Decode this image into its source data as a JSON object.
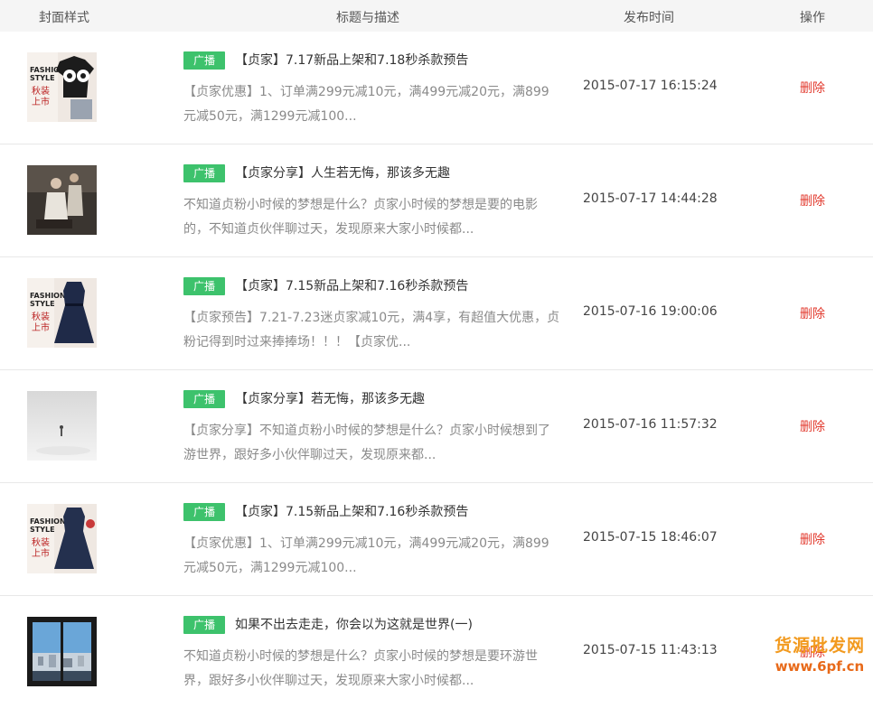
{
  "header": {
    "cover_label": "封面样式",
    "title_label": "标题与描述",
    "time_label": "发布时间",
    "action_label": "操作"
  },
  "rows": [
    {
      "badge": "广播",
      "title": "【贞家】7.17新品上架和7.18秒杀款预告",
      "desc": "【贞家优惠】1、订单满299元减10元，满499元减20元，满899元减50元，满1299元减100...",
      "time": "2015-07-17 16:15:24",
      "action": "删除",
      "cover": "fashion-panda"
    },
    {
      "badge": "广播",
      "title": "【贞家分享】人生若无悔，那该多无趣",
      "desc": "不知道贞粉小时候的梦想是什么？贞家小时候的梦想是要的电影的，不知道贞伙伴聊过天，发现原来大家小时候都...",
      "time": "2015-07-17 14:44:28",
      "action": "删除",
      "cover": "couple-photo"
    },
    {
      "badge": "广播",
      "title": "【贞家】7.15新品上架和7.16秒杀款预告",
      "desc": "【贞家预告】7.21-7.23迷贞家减10元，满4享，有超值大优惠，贞粉记得到时过来捧捧场！！！【贞家优...",
      "time": "2015-07-16 19:00:06",
      "action": "删除",
      "cover": "fashion-dress"
    },
    {
      "badge": "广播",
      "title": "【贞家分享】若无悔，那该多无趣",
      "desc": "【贞家分享】不知道贞粉小时候的梦想是什么？贞家小时候想到了游世界，跟好多小伙伴聊过天，发现原来都...",
      "time": "2015-07-16 11:57:32",
      "action": "删除",
      "cover": "misty-figure"
    },
    {
      "badge": "广播",
      "title": "【贞家】7.15新品上架和7.16秒杀款预告",
      "desc": "【贞家优惠】1、订单满299元减10元，满499元减20元，满899元减50元，满1299元减100...",
      "time": "2015-07-15 18:46:07",
      "action": "删除",
      "cover": "fashion-dress"
    },
    {
      "badge": "广播",
      "title": "如果不出去走走，你会以为这就是世界(一)",
      "desc": "不知道贞粉小时候的梦想是什么？贞家小时候的梦想是要环游世界，跟好多小伙伴聊过天，发现原来大家小时候都...",
      "time": "2015-07-15 11:43:13",
      "action": "删除",
      "cover": "city-window"
    }
  ],
  "watermark": {
    "line1": "货源批发网",
    "line2": "www.6pf.cn"
  }
}
